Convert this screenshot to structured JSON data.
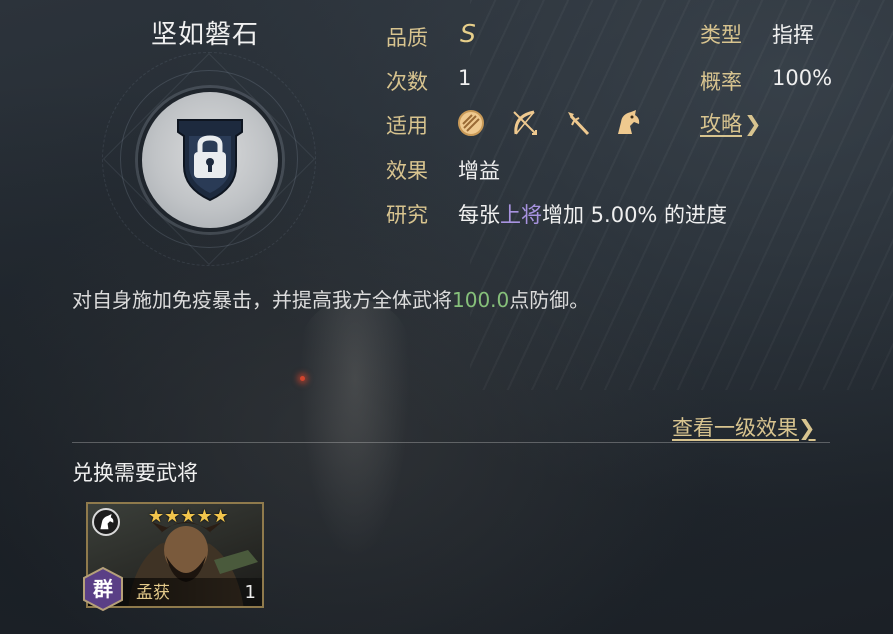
{
  "skill": {
    "name": "坚如磐石",
    "description_pre": "对自身施加免疫暴击，并提高我方全体武将",
    "description_value": "100.0",
    "description_post": "点防御。"
  },
  "info": {
    "quality_label": "品质",
    "quality_value": "S",
    "count_label": "次数",
    "count_value": "1",
    "apply_label": "适用",
    "effect_label": "效果",
    "effect_value": "增益",
    "research_label": "研究",
    "research_pre": "每张",
    "research_highlight": "上将",
    "research_post": "增加 5.00% 的进度",
    "type_label": "类型",
    "type_value": "指挥",
    "rate_label": "概率",
    "rate_value": "100%",
    "guide_link": "攻略",
    "applicable_troops": [
      "shield-icon",
      "bow-icon",
      "spear-icon",
      "cavalry-icon"
    ]
  },
  "actions": {
    "view_level1": "查看一级效果"
  },
  "exchange": {
    "title": "兑换需要武将",
    "hero": {
      "name": "孟获",
      "faction": "群",
      "stars": 5,
      "count": "1",
      "troop_icon": "cavalry-icon"
    }
  },
  "colors": {
    "label_gold": "#d8c48f",
    "highlight_purple": "#a893e0",
    "value_green": "#86c07a",
    "star_gold": "#f2c54c"
  }
}
